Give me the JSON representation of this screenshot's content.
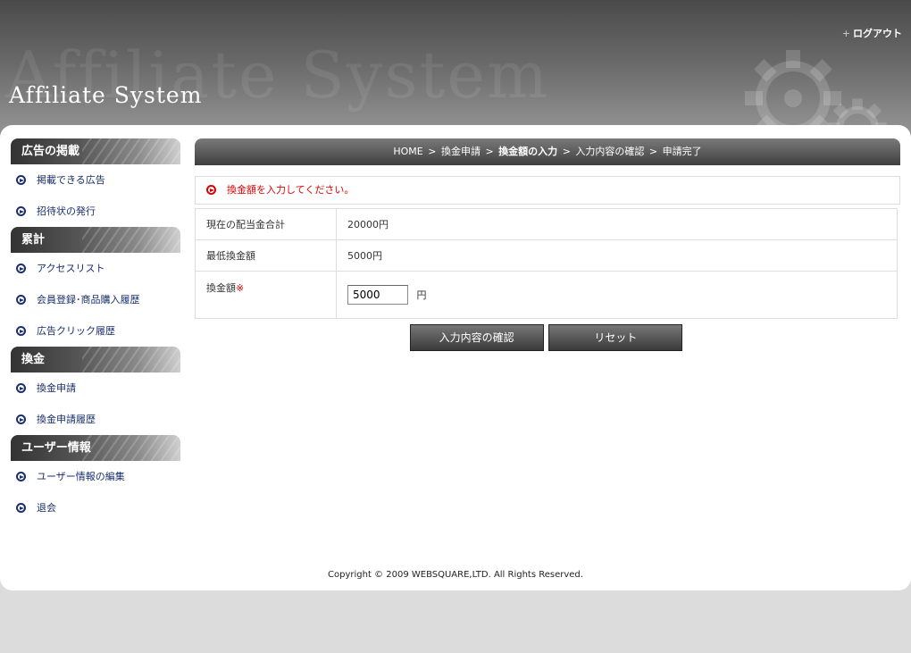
{
  "header": {
    "watermark": "Affiliate System",
    "logo": "Affiliate System",
    "logout_plus": "+",
    "logout_label": "ログアウト"
  },
  "sidebar": {
    "sections": [
      {
        "title": "広告の掲載",
        "items": [
          "掲載できる広告",
          "招待状の発行"
        ]
      },
      {
        "title": "累計",
        "items": [
          "アクセスリスト",
          "会員登録･商品購入履歴",
          "広告クリック履歴"
        ]
      },
      {
        "title": "換金",
        "items": [
          "換金申請",
          "換金申請履歴"
        ]
      },
      {
        "title": "ユーザー情報",
        "items": [
          "ユーザー情報の編集",
          "退会"
        ]
      }
    ]
  },
  "breadcrumb": {
    "home": "HOME",
    "step1": "換金申請",
    "current": "換金額の入力",
    "step3": "入力内容の確認",
    "step4": "申請完了",
    "separator": ">"
  },
  "message": "換金額を入力してください。",
  "form": {
    "row1_label": "現在の配当金合計",
    "row1_value": "20000円",
    "row2_label": "最低換金額",
    "row2_value": "5000円",
    "row3_label": "換金額",
    "required_mark": "※",
    "amount_value": "5000",
    "unit": "円"
  },
  "buttons": {
    "confirm": "入力内容の確認",
    "reset": "リセット"
  },
  "footer": {
    "copyright": "Copyright © 2009 WEBSQUARE,LTD. All Rights Reserved."
  },
  "colors": {
    "link": "#1a2f6b",
    "required": "#dd0000",
    "header_dark": "#4a4a4a"
  }
}
